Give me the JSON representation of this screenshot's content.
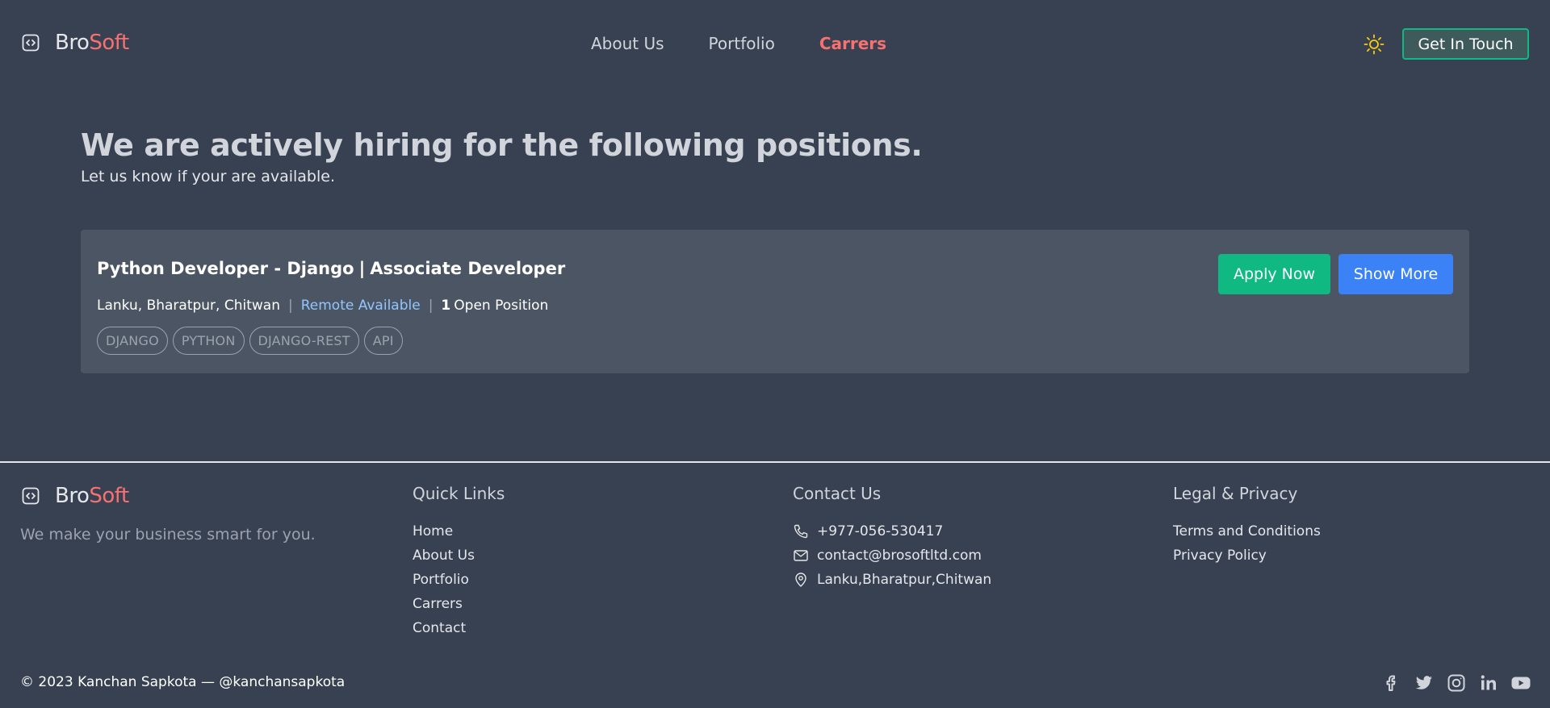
{
  "header": {
    "brand": {
      "part1": "Bro",
      "part2": "Soft"
    },
    "nav": [
      {
        "label": "About Us"
      },
      {
        "label": "Portfolio"
      },
      {
        "label": "Carrers",
        "active": true
      }
    ],
    "theme_icon": "sun-icon",
    "cta_label": "Get In Touch"
  },
  "hero": {
    "title": "We are actively hiring for the following positions.",
    "subtitle": "Let us know if your are available."
  },
  "job": {
    "title": "Python Developer - Django",
    "separator": "|",
    "level": "Associate Developer",
    "location": "Lanku, Bharatpur, Chitwan",
    "remote": "Remote Available",
    "open_count": "1",
    "open_label": "Open Position",
    "tags": [
      "DJANGO",
      "PYTHON",
      "DJANGO-REST",
      "API"
    ],
    "apply_label": "Apply Now",
    "more_label": "Show More"
  },
  "footer": {
    "brand": {
      "part1": "Bro",
      "part2": "Soft"
    },
    "tagline": "We make your business smart for you.",
    "quick_links": {
      "heading": "Quick Links",
      "items": [
        "Home",
        "About Us",
        "Portfolio",
        "Carrers",
        "Contact"
      ]
    },
    "contact": {
      "heading": "Contact Us",
      "phone": "+977-056-530417",
      "email": "contact@brosoftltd.com",
      "address": "Lanku,Bharatpur,Chitwan"
    },
    "legal": {
      "heading": "Legal & Privacy",
      "items": [
        "Terms and Conditions",
        "Privacy Policy"
      ]
    },
    "copyright": "© 2023 Kanchan Sapkota — @kanchansapkota",
    "socials": [
      "facebook-icon",
      "twitter-icon",
      "instagram-icon",
      "linkedin-icon",
      "youtube-icon"
    ]
  },
  "colors": {
    "background": "#374151",
    "card": "#4b5563",
    "accent_red": "#f87171",
    "accent_green": "#10b981",
    "accent_blue": "#3b82f6",
    "sun": "#facc15"
  }
}
